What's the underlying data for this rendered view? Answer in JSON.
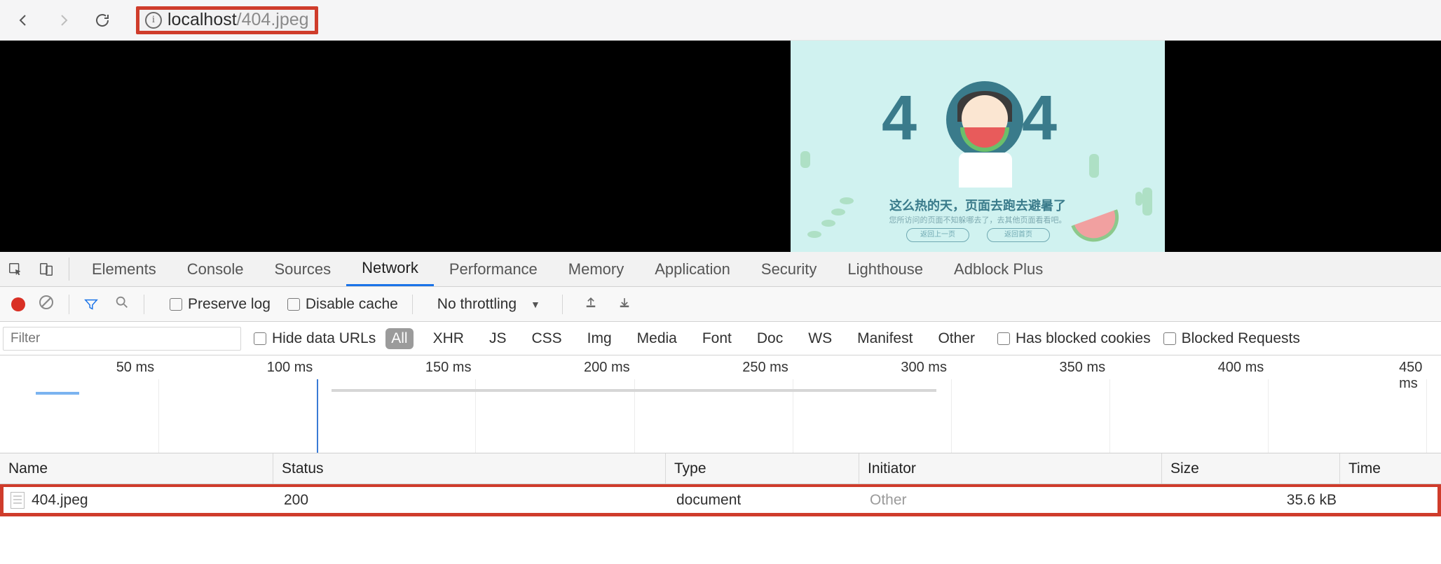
{
  "browser": {
    "url_host": "localhost",
    "url_path": "/404.jpeg",
    "info_glyph": "i"
  },
  "err_image": {
    "four_left": "4",
    "four_right": "4",
    "title": "这么热的天，页面去跑去避暑了",
    "subtitle": "您所访问的页面不知躲哪去了，去其他页面看看吧。",
    "btn_a": "返回上一页",
    "btn_b": "返回首页"
  },
  "devtools_tabs": {
    "items": [
      "Elements",
      "Console",
      "Sources",
      "Network",
      "Performance",
      "Memory",
      "Application",
      "Security",
      "Lighthouse",
      "Adblock Plus"
    ],
    "active_index": 3
  },
  "network_toolbar": {
    "preserve_log": "Preserve log",
    "disable_cache": "Disable cache",
    "throttling": "No throttling"
  },
  "filter_row": {
    "placeholder": "Filter",
    "hide_data_urls": "Hide data URLs",
    "types": [
      "All",
      "XHR",
      "JS",
      "CSS",
      "Img",
      "Media",
      "Font",
      "Doc",
      "WS",
      "Manifest",
      "Other"
    ],
    "blocked_cookies": "Has blocked cookies",
    "blocked_requests": "Blocked Requests"
  },
  "timeline": {
    "labels": [
      "50 ms",
      "100 ms",
      "150 ms",
      "200 ms",
      "250 ms",
      "300 ms",
      "350 ms",
      "400 ms",
      "450 ms"
    ],
    "label_percents": [
      11,
      22,
      33,
      44,
      55,
      66,
      77,
      88,
      99
    ],
    "cursor_percent": 22,
    "bar_left_percent": 2.5,
    "bar_width_percent": 3,
    "range_left_percent": 23,
    "range_width_percent": 42
  },
  "table": {
    "headers": [
      "Name",
      "Status",
      "Type",
      "Initiator",
      "Size",
      "Time"
    ],
    "row": {
      "name": "404.jpeg",
      "status": "200",
      "type": "document",
      "initiator": "Other",
      "size": "35.6 kB",
      "time": ""
    }
  }
}
